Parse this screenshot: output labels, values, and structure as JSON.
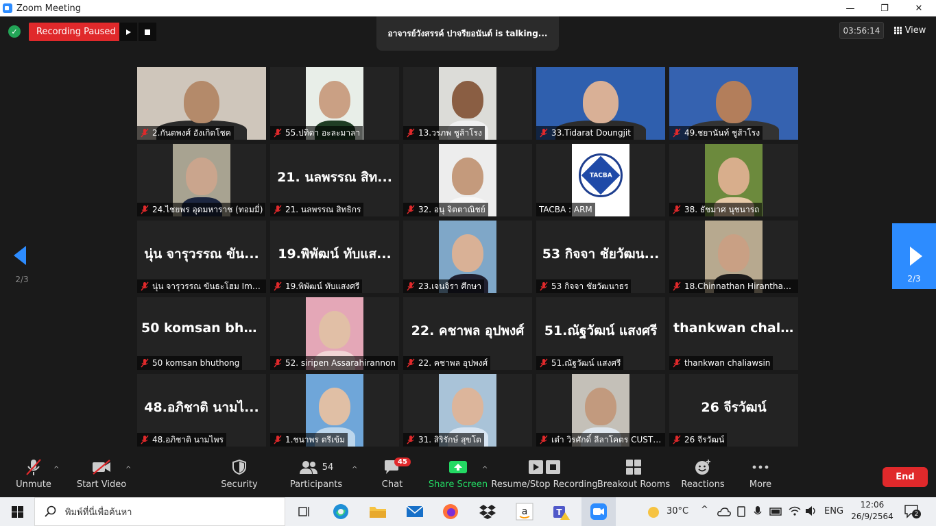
{
  "window": {
    "title": "Zoom Meeting",
    "minimize": "—",
    "maximize": "❐",
    "close": "✕"
  },
  "topbar": {
    "recording_status": "Recording Paused",
    "talking": "อาจารย์วังสรรค์  ปาจรียอนันต์ is talking...",
    "elapsed": "03:56:14",
    "view_label": "View"
  },
  "pager": {
    "left": "2/3",
    "right": "2/3"
  },
  "tiles": [
    {
      "name": "2.กันตพงศ์ อังเกิดโชค",
      "big": "",
      "video": "full",
      "bg": "#cfc6bb",
      "skin": "#b48a6a",
      "shirt": "#2a2a2a"
    },
    {
      "name": "55.ปทิดา อะละมาลา",
      "big": "",
      "video": "center",
      "bg": "#e8eee8",
      "skin": "#caa084",
      "shirt": "#1f3d24"
    },
    {
      "name": "13.วรภพ ชูส้าโรง",
      "big": "",
      "video": "center",
      "bg": "#dcdcd8",
      "skin": "#8a5e43",
      "shirt": "#f0f0f0"
    },
    {
      "name": "33.Tidarat Doungjit",
      "big": "",
      "video": "full",
      "bg": "#2f5fae",
      "skin": "#d9b096",
      "shirt": "#2c2c2c"
    },
    {
      "name": "49.ชยานันท์ ชูส้าโรง",
      "big": "",
      "video": "full",
      "bg": "#3562b0",
      "skin": "#b37e5b",
      "shirt": "#333333"
    },
    {
      "name": "24.ไชยพร อุดมหาราช (ทอมมี่)",
      "big": "",
      "video": "center",
      "bg": "#a8a391",
      "skin": "#caa58d",
      "shirt": "#1c2640"
    },
    {
      "name": "21. นลพรรณ สิทธิกร",
      "big": "21. นลพรรณ สิท...",
      "video": "none"
    },
    {
      "name": "32. อนุ จิตตาณิชย์",
      "big": "",
      "video": "center",
      "bg": "#ededed",
      "skin": "#c49a7c",
      "shirt": "#f7f7f7"
    },
    {
      "name": "TACBA : ARM",
      "big": "",
      "video": "logo",
      "logo_text": "TACBA"
    },
    {
      "name": "38. ธัชมาศ นุชนารถ",
      "big": "",
      "video": "center",
      "bg": "#6c8a3d",
      "skin": "#d8ae8c",
      "shirt": "#e7c9a7"
    },
    {
      "name": "นุ่น จารุวรรณ ขันธะโฮม Imp...",
      "big": "นุ่น จารุวรรณ ขัน...",
      "video": "none"
    },
    {
      "name": "19.พิพัฒน์ ทับแสงศรี",
      "big": "19.พิพัฒน์ ทับแส...",
      "video": "none"
    },
    {
      "name": "23.เจนจิรา ศึกษา",
      "big": "",
      "video": "center",
      "bg": "#7fa7c8",
      "skin": "#d9b196",
      "shirt": "#202030"
    },
    {
      "name": "53 กิจจา ชัยวัฒนาธร",
      "big": "53 กิจจา ชัยวัฒน...",
      "video": "none"
    },
    {
      "name": "18.Chinnathan Hiranthanaku...",
      "big": "",
      "video": "center",
      "bg": "#b7a98f",
      "skin": "#c9a084",
      "shirt": "#1c1c1c"
    },
    {
      "name": "50 komsan bhuthong",
      "big": "50 komsan bhu...",
      "video": "none"
    },
    {
      "name": "52. siripen Assarahirannon",
      "big": "",
      "video": "center",
      "bg": "#e4a7b7",
      "skin": "#e1bfa6",
      "shirt": "#f2d6d6"
    },
    {
      "name": "22. คชาพล อุปพงศ์",
      "big": "22. คชาพล อุปพงศ์",
      "video": "none"
    },
    {
      "name": "51.ณัฐวัฒน์ แสงศรี",
      "big": "51.ณัฐวัฒน์ แสงศรี",
      "video": "none"
    },
    {
      "name": "thankwan chaliawsin",
      "big": "thankwan chali...",
      "video": "none"
    },
    {
      "name": "48.อภิชาติ นามไพร",
      "big": "48.อภิชาติ นามไ...",
      "video": "none"
    },
    {
      "name": "1.ชนาพร ตรีเข้ม",
      "big": "",
      "video": "center",
      "bg": "#6fa6d9",
      "skin": "#e0bfa5",
      "shirt": "#bcd6ec"
    },
    {
      "name": "31. สิริรักษ์ สุขโต",
      "big": "",
      "video": "center",
      "bg": "#a9c3d8",
      "skin": "#dcb59b",
      "shirt": "#d8e5f2"
    },
    {
      "name": "เต๋า วิรศักดิ์ ลีลาโคตร CUSTO...",
      "big": "",
      "video": "center",
      "bg": "#c4c0b8",
      "skin": "#c29a7e",
      "shirt": "#dfe7ef"
    },
    {
      "name": "26 จีรวัฒน์",
      "big": "26 จีรวัฒน์",
      "video": "none"
    }
  ],
  "toolbar": {
    "unmute": "Unmute",
    "start_video": "Start Video",
    "security": "Security",
    "participants": "Participants",
    "participants_count": "54",
    "chat": "Chat",
    "chat_badge": "45",
    "share_screen": "Share Screen",
    "recording": "Resume/Stop Recording",
    "breakout": "Breakout Rooms",
    "reactions": "Reactions",
    "more": "More",
    "end": "End"
  },
  "taskbar": {
    "search_placeholder": "พิมพ์ที่นี่เพื่อค้นหา",
    "temperature": "30°C",
    "language": "ENG",
    "time": "12:06",
    "date": "26/9/2564",
    "notifications": "2"
  },
  "colors": {
    "accent": "#2d8cff",
    "record": "#e0292b",
    "share": "#23d963"
  }
}
